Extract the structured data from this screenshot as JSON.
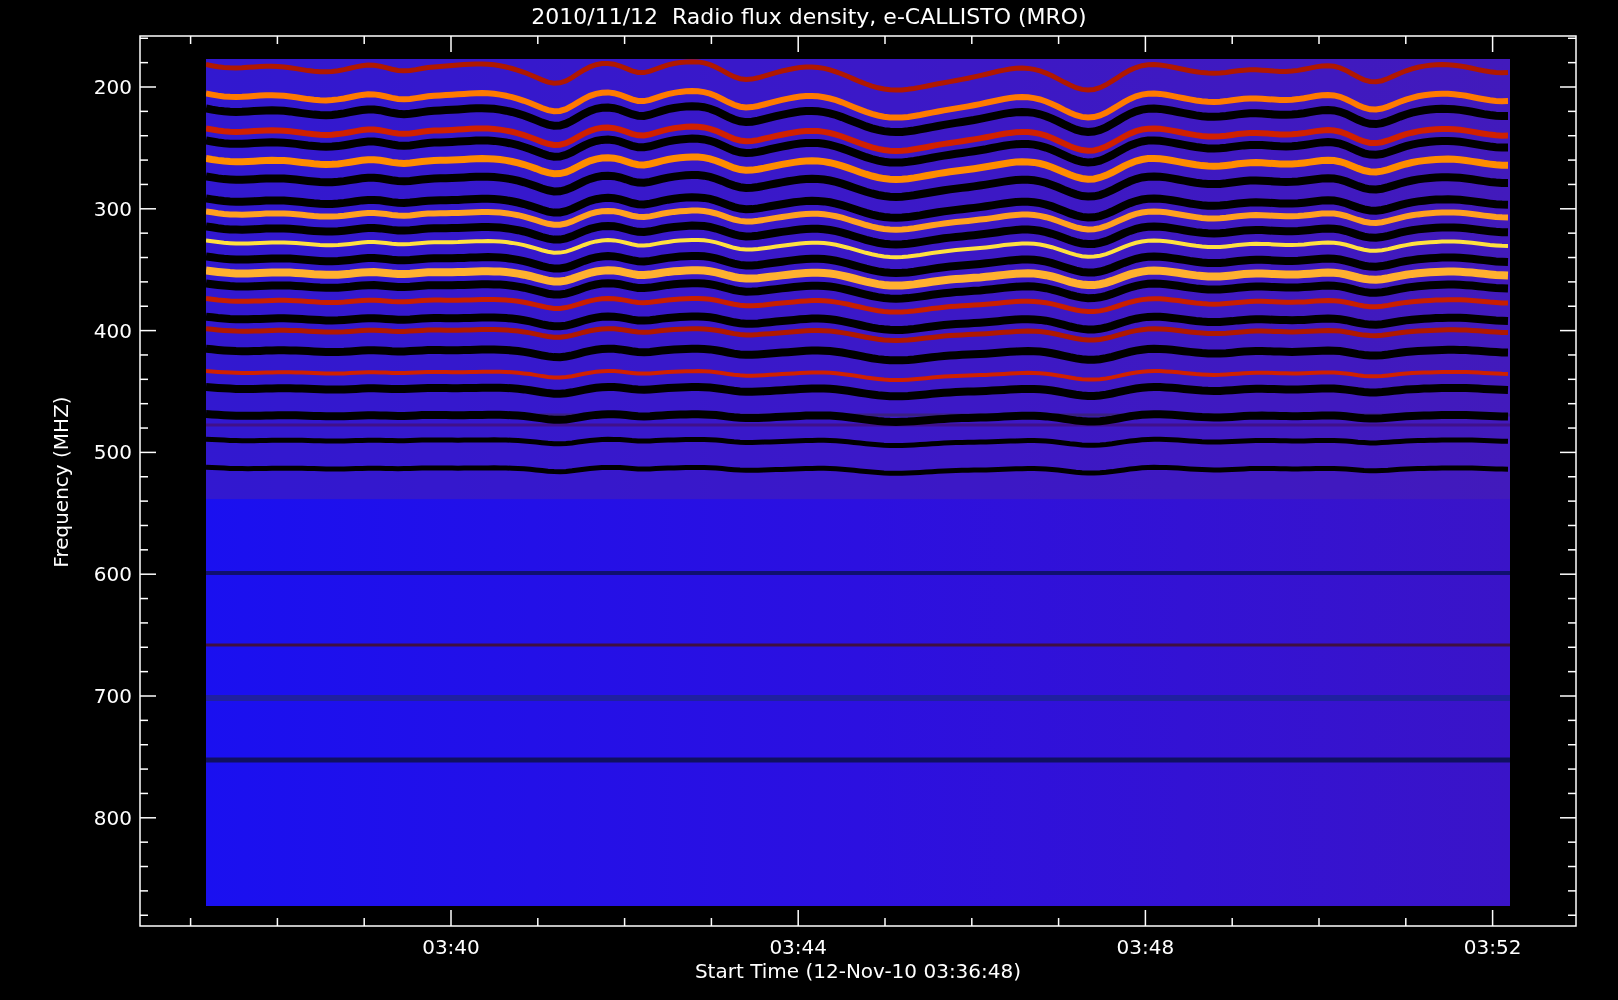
{
  "title": "2010/11/12  Radio flux density, e-CALLISTO (MRO)",
  "y_axis": {
    "label": "Frequency (MHZ)",
    "ticks": [
      "200",
      "300",
      "400",
      "500",
      "600",
      "700",
      "800"
    ]
  },
  "x_axis": {
    "label": "Start Time (12-Nov-10 03:36:48)",
    "ticks": [
      "03:40",
      "03:44",
      "03:48",
      "03:52"
    ]
  }
}
